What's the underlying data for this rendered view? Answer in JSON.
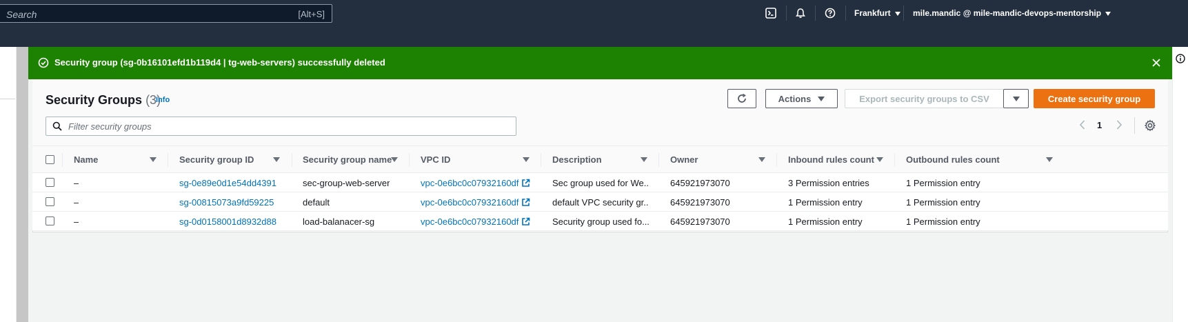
{
  "topnav": {
    "search_placeholder": "Search",
    "search_shortcut": "[Alt+S]",
    "region": "Frankfurt",
    "account": "mile.mandic @ mile-mandic-devops-mentorship",
    "icons": [
      "cloudshell-icon",
      "notifications-icon",
      "help-icon"
    ]
  },
  "flash": {
    "message": "Security group (sg-0b16101efd1b119d4 | tg-web-servers) successfully deleted",
    "color": "#1d8102"
  },
  "header": {
    "title": "Security Groups",
    "count": "(3)",
    "info": "Info"
  },
  "toolbar": {
    "actions_label": "Actions",
    "export_label": "Export security groups to CSV",
    "create_label": "Create security group",
    "filter_placeholder": "Filter security groups",
    "page": "1"
  },
  "table": {
    "columns": [
      "Name",
      "Security group ID",
      "Security group name",
      "VPC ID",
      "Description",
      "Owner",
      "Inbound rules count",
      "Outbound rules count"
    ],
    "rows": [
      {
        "name": "–",
        "sg_id": "sg-0e89e0d1e54dd4391",
        "sg_name": "sec-group-web-server",
        "vpc_id": "vpc-0e6bc0c07932160df",
        "description": "Sec group used for We...",
        "owner": "645921973070",
        "inbound": "3 Permission entries",
        "outbound": "1 Permission entry"
      },
      {
        "name": "–",
        "sg_id": "sg-00815073a9fd59225",
        "sg_name": "default",
        "vpc_id": "vpc-0e6bc0c07932160df",
        "description": "default VPC security gr...",
        "owner": "645921973070",
        "inbound": "1 Permission entry",
        "outbound": "1 Permission entry"
      },
      {
        "name": "–",
        "sg_id": "sg-0d0158001d8932d88",
        "sg_name": "load-balanacer-sg",
        "vpc_id": "vpc-0e6bc0c07932160df",
        "description": "Security group used fo...",
        "owner": "645921973070",
        "inbound": "1 Permission entry",
        "outbound": "1 Permission entry"
      }
    ]
  },
  "colors": {
    "nav_bg": "#232f3e",
    "link": "#0073bb",
    "primary": "#ec7211"
  }
}
